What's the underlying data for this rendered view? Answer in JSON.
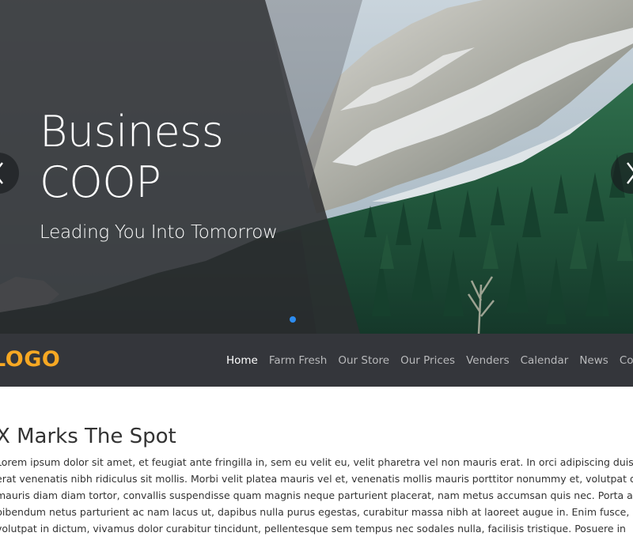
{
  "hero": {
    "title_line1": "Business",
    "title_line2": "COOP",
    "subtitle": "Leading You Into Tomorrow",
    "prev_label": "previous slide",
    "next_label": "next slide",
    "active_slide": 1,
    "slide_count": 1
  },
  "navbar": {
    "logo": "LOGO",
    "links": [
      {
        "label": "Home",
        "active": true
      },
      {
        "label": "Farm Fresh",
        "active": false
      },
      {
        "label": "Our Store",
        "active": false
      },
      {
        "label": "Our Prices",
        "active": false
      },
      {
        "label": "Venders",
        "active": false
      },
      {
        "label": "Calendar",
        "active": false
      },
      {
        "label": "News",
        "active": false
      },
      {
        "label": "Contact",
        "active": false
      }
    ]
  },
  "main": {
    "heading": "X Marks The Spot",
    "paragraph_lines": [
      "Lorem ipsum dolor sit amet, et feugiat ante fringilla in, sem eu velit eu, velit pharetra vel non mauris erat. In orci adipiscing duis, ac",
      "erat venenatis nibh ridiculus sit mollis. Morbi velit platea mauris vel et, venenatis mollis mauris porttitor nonummy et, volutpat dui",
      "mauris diam diam tortor, convallis suspendisse quam magnis neque parturient placerat, nam metus accumsan quis nec. Porta at in,",
      "bibendum netus parturient ac nam lacus ut, dapibus nulla purus egestas, curabitur massa nibh at laoreet augue in. Enim fusce,",
      "volutpat in dictum, vivamus dolor curabitur tincidunt, pellentesque sem tempus nec sodales nulla, facilisis tristique. Posuere in"
    ]
  },
  "colors": {
    "navbar_bg": "#34363b",
    "logo": "#f7a823",
    "nav_active": "#ffffff",
    "nav_inactive": "#b8b9bb",
    "dot_active": "#2d8cf0",
    "overlay": "#2f3033"
  },
  "icons": {
    "prev": "chevron-left-icon",
    "next": "chevron-right-icon"
  }
}
